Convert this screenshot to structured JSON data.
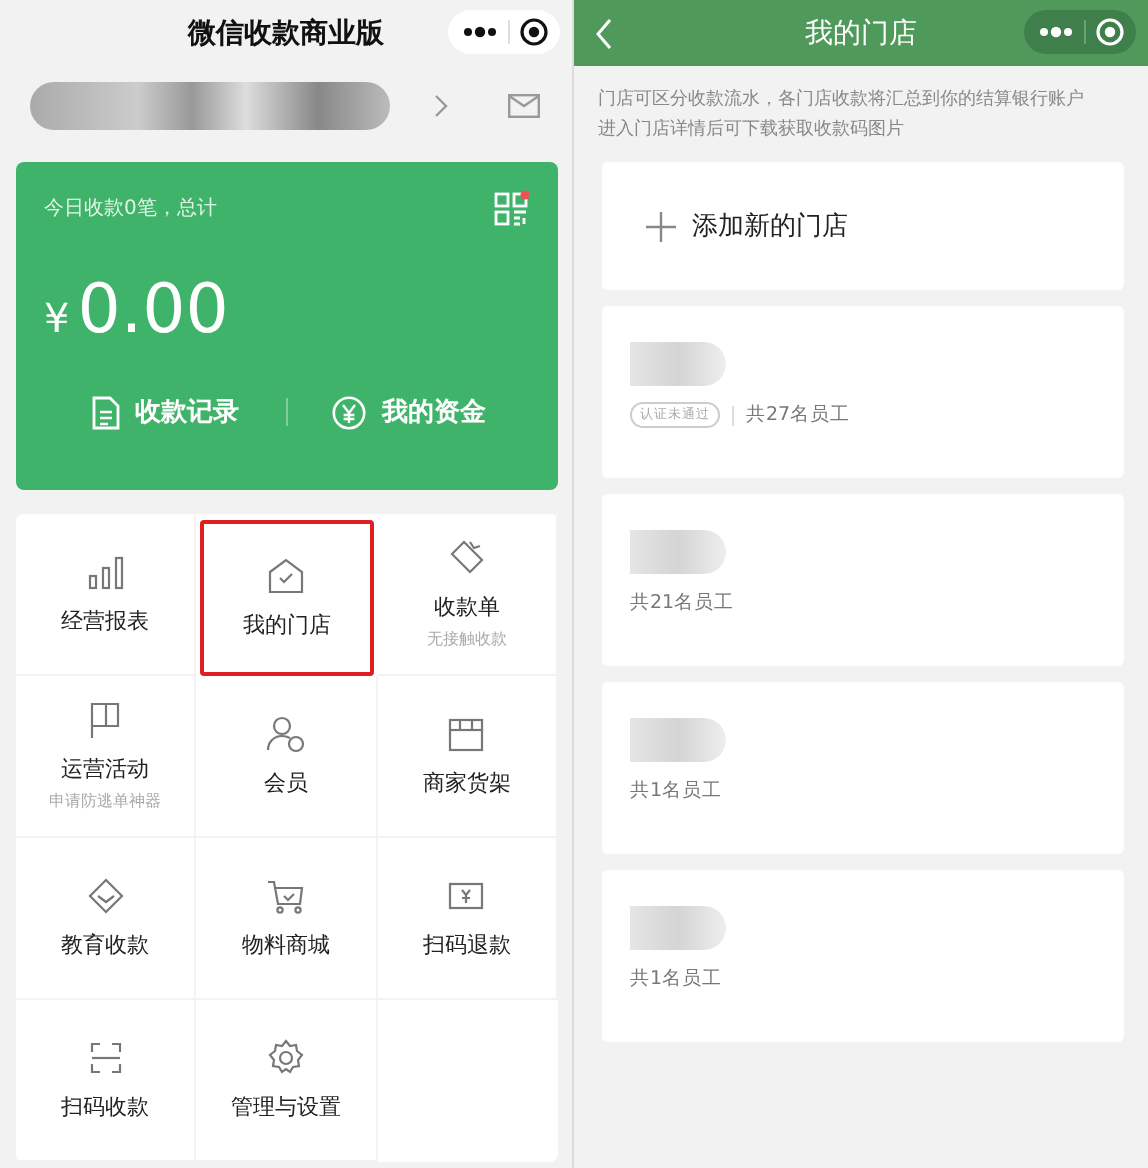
{
  "left": {
    "title": "微信收款商业版",
    "summary": {
      "caption": "今日收款0笔，总计",
      "currency": "¥",
      "amount": "0.00",
      "qr_badge": true,
      "actions": [
        {
          "label": "收款记录"
        },
        {
          "label": "我的资金"
        }
      ]
    },
    "menu": [
      {
        "label": "经营报表",
        "highlighted": false
      },
      {
        "label": "我的门店",
        "highlighted": true
      },
      {
        "label": "收款单",
        "sublabel": "无接触收款",
        "highlighted": false
      },
      {
        "label": "运营活动",
        "sublabel": "申请防逃单神器",
        "highlighted": false
      },
      {
        "label": "会员",
        "highlighted": false
      },
      {
        "label": "商家货架",
        "highlighted": false
      },
      {
        "label": "教育收款",
        "highlighted": false
      },
      {
        "label": "物料商城",
        "highlighted": false
      },
      {
        "label": "扫码退款",
        "highlighted": false
      },
      {
        "label": "扫码收款",
        "highlighted": false
      },
      {
        "label": "管理与设置",
        "highlighted": false
      }
    ]
  },
  "right": {
    "title": "我的门店",
    "description": [
      "门店可区分收款流水，各门店收款将汇总到你的结算银行账户",
      "进入门店详情后可下载获取收款码图片"
    ],
    "add_store": "添加新的门店",
    "stores": [
      {
        "badge": "认证未通过",
        "staff": "共27名员工"
      },
      {
        "staff": "共21名员工"
      },
      {
        "staff": "共1名员工"
      },
      {
        "staff": "共1名员工"
      }
    ]
  }
}
